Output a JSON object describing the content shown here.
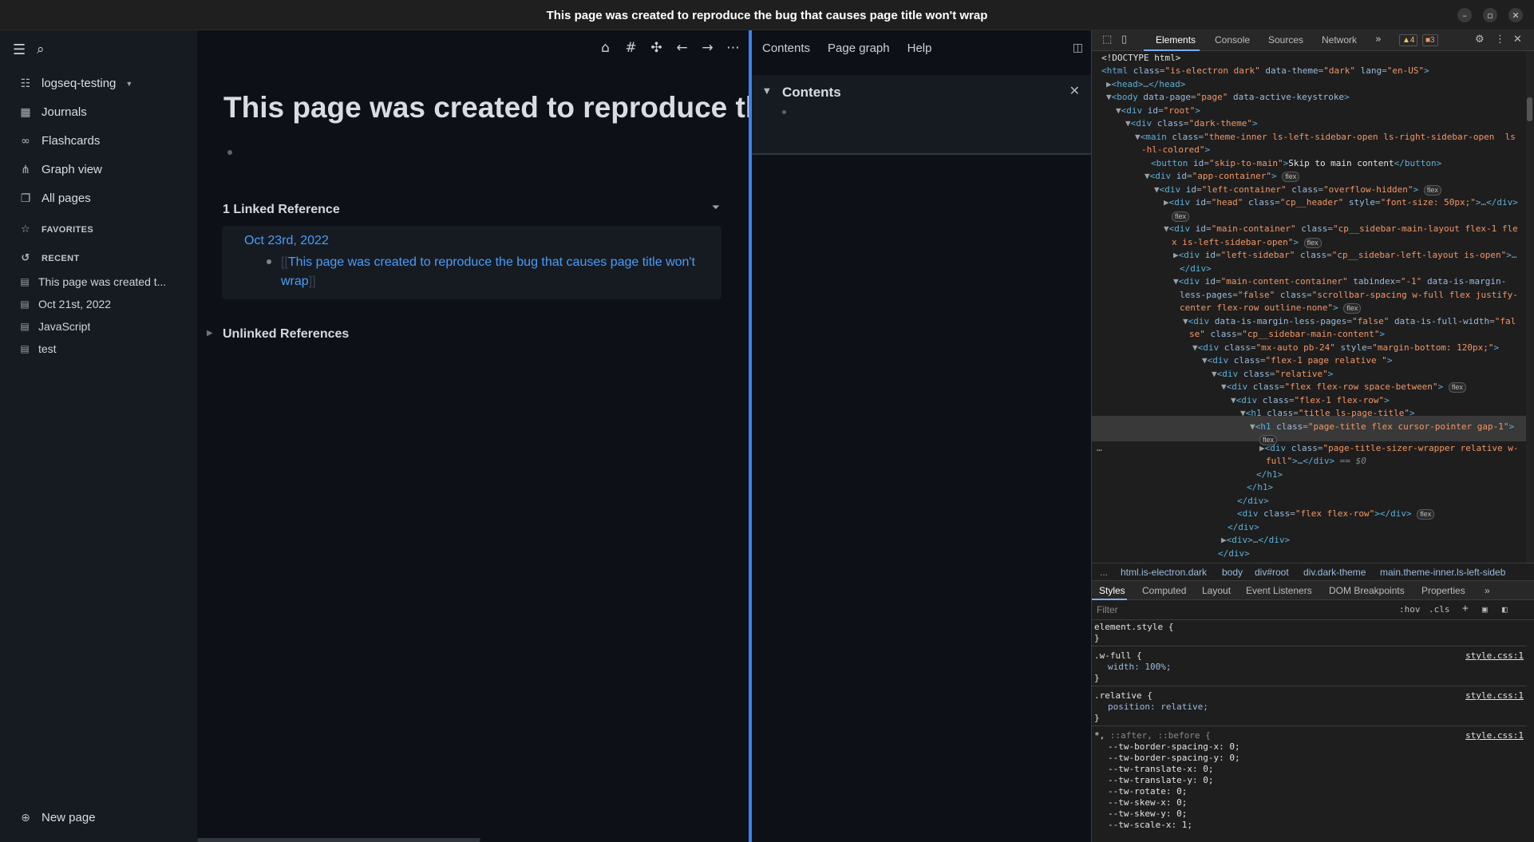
{
  "window": {
    "title": "This page was created to reproduce the bug that causes page title won't wrap",
    "controls": [
      "minimize",
      "maximize",
      "close"
    ]
  },
  "left_sidebar": {
    "graph_name": "logseq-testing",
    "nav": [
      {
        "label": "Journals",
        "icon": "calendar-icon"
      },
      {
        "label": "Flashcards",
        "icon": "infinity-icon"
      },
      {
        "label": "Graph view",
        "icon": "graph-icon"
      },
      {
        "label": "All pages",
        "icon": "pages-icon"
      }
    ],
    "favorites_label": "FAVORITES",
    "recent_label": "RECENT",
    "recent": [
      "This page was created t...",
      "Oct 21st, 2022",
      "JavaScript",
      "test"
    ],
    "new_page_label": "New page"
  },
  "main": {
    "page_title": "This page was created to reproduce the bug that causes page title won't wrap",
    "linked_refs_header": "1 Linked Reference",
    "ref_date": "Oct 23rd, 2022",
    "ref_text": "This page was created to reproduce the bug that causes page title won't wrap",
    "unlinked_refs_header": "Unlinked References"
  },
  "right_sidebar": {
    "tabs": [
      "Contents",
      "Page graph",
      "Help"
    ],
    "panel_title": "Contents"
  },
  "devtools": {
    "tabs": [
      "Elements",
      "Console",
      "Sources",
      "Network"
    ],
    "warnings": "4",
    "issues": "3",
    "breadcrumb": [
      "...",
      "html.is-electron.dark",
      "body",
      "div#root",
      "div.dark-theme",
      "main.theme-inner.ls-left-sideb"
    ],
    "subtabs": [
      "Styles",
      "Computed",
      "Layout",
      "Event Listeners",
      "DOM Breakpoints",
      "Properties"
    ],
    "filter_placeholder": "Filter",
    "hov": ":hov",
    "cls": ".cls",
    "styles": {
      "element_style": "element.style {",
      "w_full_selector": ".w-full {",
      "w_full_prop": "width: 100%;",
      "relative_selector": ".relative {",
      "relative_prop": "position: relative;",
      "universal_selector": "*, ",
      "universal_pseudo": "::after, ::before {",
      "source": "style.css:1",
      "tw_props": [
        "--tw-border-spacing-x: 0;",
        "--tw-border-spacing-y: 0;",
        "--tw-translate-x: 0;",
        "--tw-translate-y: 0;",
        "--tw-rotate: 0;",
        "--tw-skew-x: 0;",
        "--tw-skew-y: 0;",
        "--tw-scale-x: 1;"
      ]
    }
  }
}
